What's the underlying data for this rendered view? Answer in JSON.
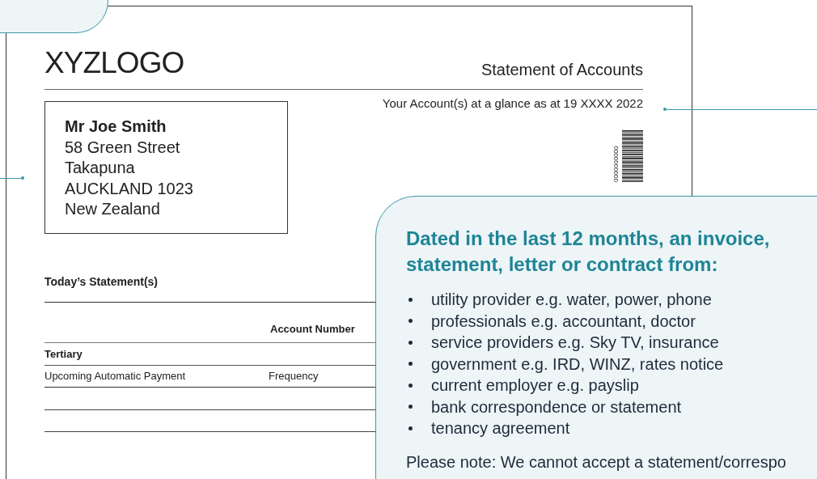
{
  "document": {
    "logo": "XYZLOGO",
    "title": "Statement of Accounts",
    "glance": "Your Account(s) at a glance as at 19 XXXX 2022",
    "barcode_digits": "0000000000",
    "address": {
      "name": "Mr Joe Smith",
      "lines": [
        "58 Green Street",
        "Takapuna",
        "AUCKLAND 1023",
        "New Zealand"
      ]
    },
    "section_title": "Today’s Statement(s)",
    "table": {
      "column_header": "Account Number",
      "rows": [
        {
          "kind": "heading",
          "cells": [
            "Tertiary"
          ]
        },
        {
          "kind": "item",
          "cells": [
            "Upcoming Automatic Payment",
            "Frequency"
          ]
        },
        {
          "kind": "empty",
          "cells": []
        },
        {
          "kind": "empty",
          "cells": []
        }
      ]
    }
  },
  "callout": {
    "heading": "Dated in the last 12 months, an invoice, statement, letter or contract from:",
    "items": [
      "utility provider e.g. water, power, phone",
      "professionals e.g. accountant, doctor",
      "service providers e.g. Sky TV, insurance",
      "government e.g. IRD, WINZ, rates notice",
      "current employer e.g. payslip",
      "bank correspondence or statement",
      "tenancy agreement"
    ],
    "note": "Please note: We cannot accept a statement/correspo"
  }
}
